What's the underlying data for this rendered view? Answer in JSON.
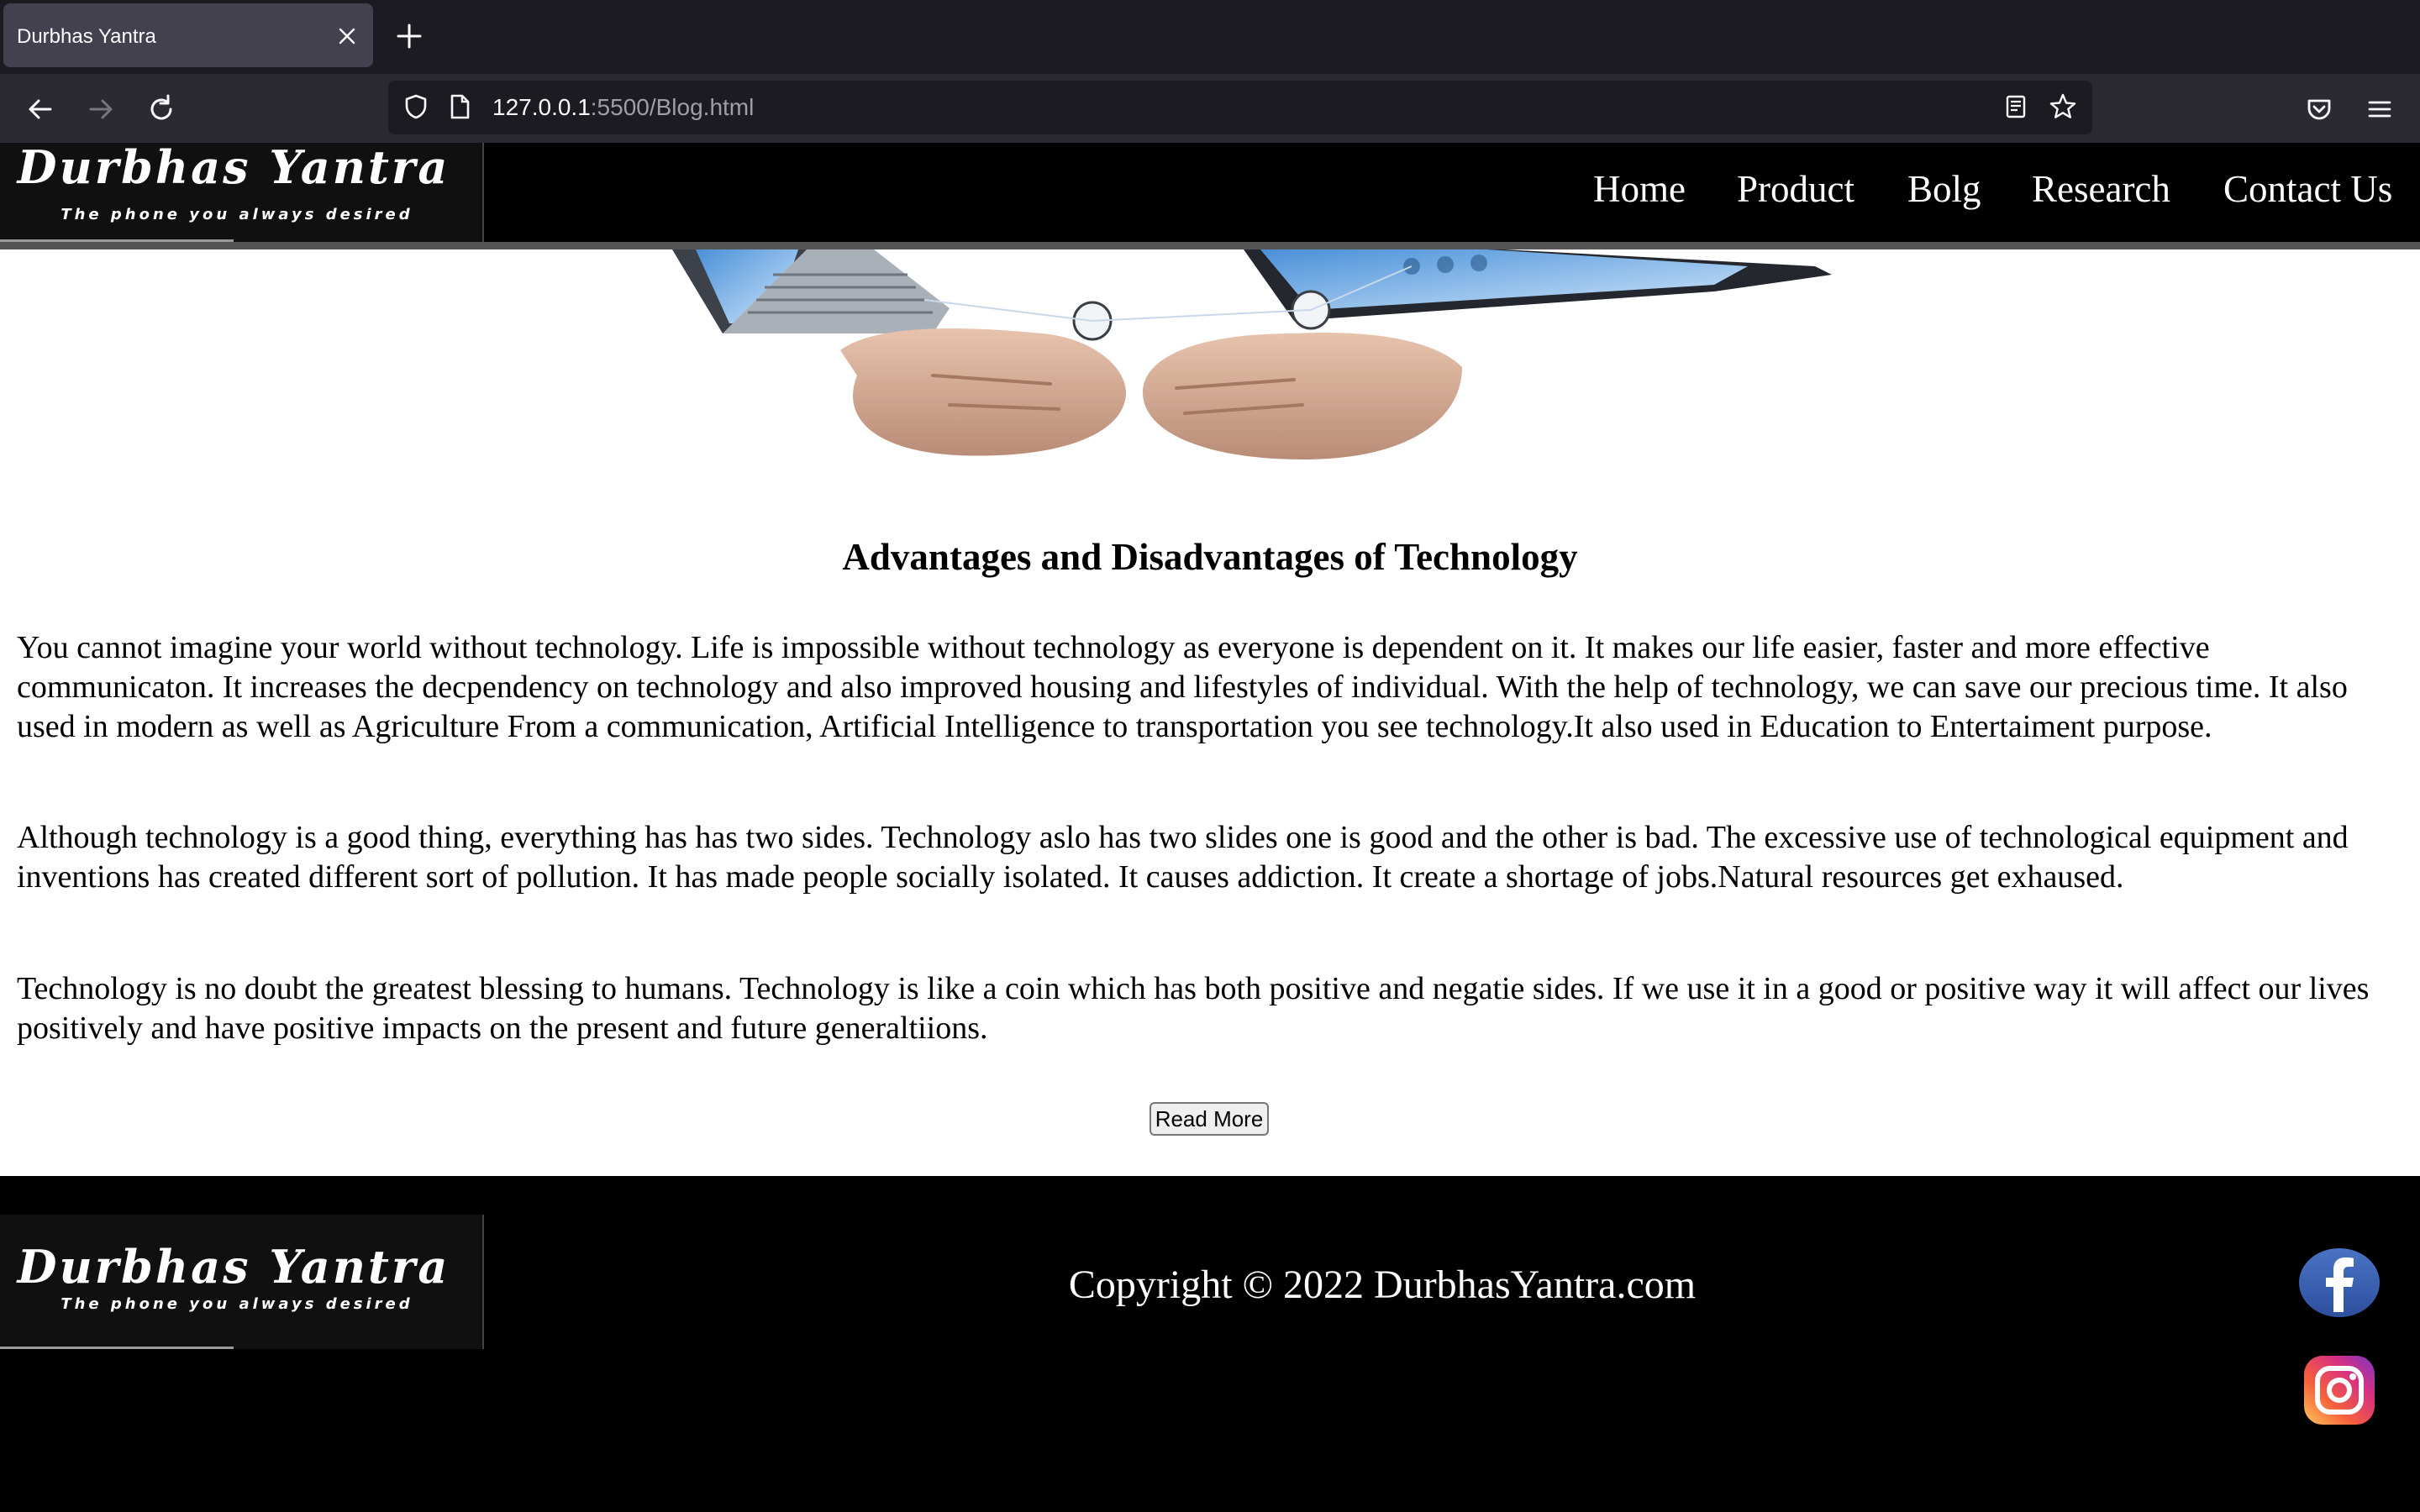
{
  "browser": {
    "tab_title": "Durbhas Yantra",
    "url_host": "127.0.0.1",
    "url_path": ":5500/Blog.html"
  },
  "site": {
    "logo_title": "Durbhas Yantra",
    "logo_tagline": "The phone you always desired",
    "nav": [
      "Home",
      "Product",
      "Bolg",
      "Research",
      "Contact Us"
    ]
  },
  "article": {
    "title": "Advantages and Disadvantages of Technology",
    "paragraphs": [
      "You cannot imagine your world without technology. Life is impossible without technology as everyone is dependent on it. It makes our life easier, faster and more effective communicaton. It increases the decpendency on technology and also improved housing and lifestyles of individual. With the help of technology, we can save our precious time. It also used in modern as well as Agriculture From a communication, Artificial Intelligence to transportation you see technology.It also used in Education to Entertaiment purpose.",
      "Although technology is a good thing, everything has has two sides. Technology aslo has two slides one is good and the other is bad. The excessive use of technological equipment and inventions has created different sort of pollution. It has made people socially isolated. It causes addiction. It create a shortage of jobs.Natural resources get exhaused.",
      "Technology is no doubt the greatest blessing to humans. Technology is like a coin which has both positive and negatie sides. If we use it in a good or positive way it will affect our lives positively and have positive impacts on the present and future generaltiions."
    ],
    "read_more_label": "Read More"
  },
  "footer": {
    "copyright": "Copyright © 2022 DurbhasYantra.com",
    "social_icons": [
      "facebook-icon",
      "instagram-icon"
    ]
  },
  "colors": {
    "header_bg": "#000000",
    "content_bg": "#ffffff",
    "browser_tabbar": "#1c1b22",
    "browser_toolbar": "#2b2a33"
  }
}
